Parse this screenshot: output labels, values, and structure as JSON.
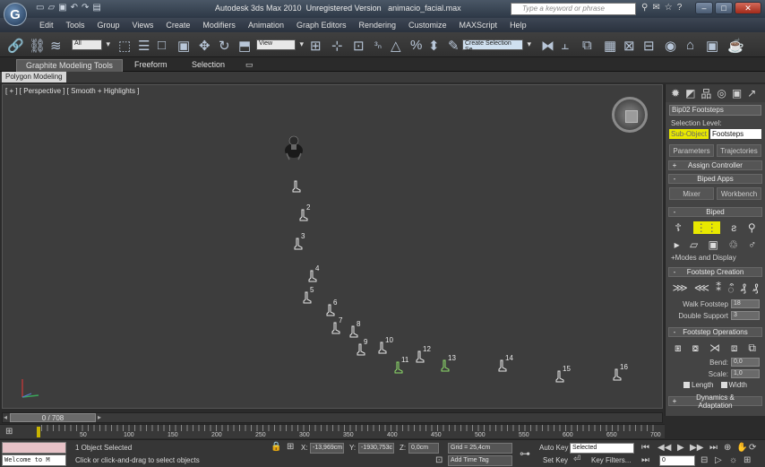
{
  "window": {
    "title_app": "Autodesk 3ds Max  2010",
    "title_version": "Unregistered Version",
    "title_file": "animacio_facial.max",
    "search_placeholder": "Type a keyword or phrase",
    "logo_letter": "G"
  },
  "menu": [
    "Edit",
    "Tools",
    "Group",
    "Views",
    "Create",
    "Modifiers",
    "Animation",
    "Graph Editors",
    "Rendering",
    "Customize",
    "MAXScript",
    "Help"
  ],
  "toolbar": {
    "filter_value": "All",
    "ref_coord_value": "View",
    "selection_set_value": "Create Selection Se"
  },
  "ribbon": {
    "tabs": [
      "Graphite Modeling Tools",
      "Freeform",
      "Selection"
    ],
    "subtab": "Polygon Modeling"
  },
  "viewport": {
    "label": "[ + ] [ Perspective ] [ Smooth + Highlights ]",
    "footsteps": [
      {
        "n": "",
        "color": "#e8e8e8"
      },
      {
        "n": "2",
        "color": "#e8e8e8"
      },
      {
        "n": "3",
        "color": "#e8e8e8"
      },
      {
        "n": "4",
        "color": "#e8e8e8"
      },
      {
        "n": "5",
        "color": "#e8e8e8"
      },
      {
        "n": "6",
        "color": "#e8e8e8"
      },
      {
        "n": "7",
        "color": "#e8e8e8"
      },
      {
        "n": "8",
        "color": "#e8e8e8"
      },
      {
        "n": "9",
        "color": "#e8e8e8"
      },
      {
        "n": "10",
        "color": "#e8e8e8"
      },
      {
        "n": "11",
        "color": "#8fe06a"
      },
      {
        "n": "12",
        "color": "#e8e8e8"
      },
      {
        "n": "13",
        "color": "#8fe06a"
      },
      {
        "n": "14",
        "color": "#e8e8e8"
      },
      {
        "n": "15",
        "color": "#e8e8e8"
      },
      {
        "n": "16",
        "color": "#e8e8e8"
      }
    ]
  },
  "command_panel": {
    "object_name": "Bip02 Footsteps",
    "selection_level_label": "Selection Level:",
    "sub_object_label": "Sub-Object",
    "selection_level_value": "Footsteps",
    "tab_parameters": "Parameters",
    "tab_trajectories": "Trajectories",
    "rollout_assign_controller": "Assign Controller",
    "rollout_biped_apps": "Biped Apps",
    "btn_mixer": "Mixer",
    "btn_workbench": "Workbench",
    "rollout_biped": "Biped",
    "modes_display": "+Modes and Display",
    "rollout_footstep_creation": "Footstep Creation",
    "walk_footstep_label": "Walk Footstep",
    "walk_footstep_value": "18",
    "double_support_label": "Double Support",
    "double_support_value": "3",
    "rollout_footstep_operations": "Footstep Operations",
    "bend_label": "Bend:",
    "bend_value": "0,0",
    "scale_label": "Scale:",
    "scale_value": "1,0",
    "length_label": "Length",
    "width_label": "Width",
    "rollout_dynamics": "Dynamics & Adaptation"
  },
  "timeline": {
    "frame_display": "0 / 708",
    "ticks": [
      "0",
      "50",
      "100",
      "150",
      "200",
      "250",
      "300",
      "350",
      "400",
      "450",
      "500",
      "550",
      "600",
      "650",
      "700"
    ]
  },
  "status": {
    "maxscript_text": "Welcome to M",
    "selected_text": "1 Object Selected",
    "prompt_text": "Click or click-and-drag to select objects",
    "x_label": "X:",
    "x_value": "-13,969cm",
    "y_label": "Y:",
    "y_value": "-1930,753c",
    "z_label": "Z:",
    "z_value": "0,0cm",
    "grid_text": "Grid = 25,4cm",
    "add_time_tag": "Add Time Tag",
    "auto_key": "Auto Key",
    "set_key": "Set Key",
    "selected_dd": "Selected",
    "key_filters": "Key Filters...",
    "frame_value": "0"
  }
}
